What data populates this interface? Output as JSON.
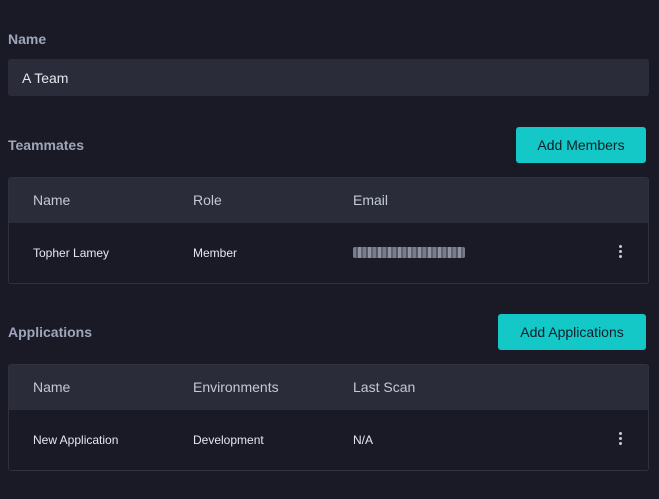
{
  "name_field": {
    "label": "Name",
    "value": "A Team"
  },
  "teammates": {
    "title": "Teammates",
    "add_button": "Add Members",
    "columns": [
      "Name",
      "Role",
      "Email"
    ],
    "rows": [
      {
        "name": "Topher Lamey",
        "role": "Member"
      }
    ]
  },
  "applications": {
    "title": "Applications",
    "add_button": "Add Applications",
    "columns": [
      "Name",
      "Environments",
      "Last Scan"
    ],
    "rows": [
      {
        "name": "New Application",
        "environment": "Development",
        "last_scan": "N/A"
      }
    ]
  },
  "colors": {
    "background": "#1a1a27",
    "panel": "#2a2c3a",
    "accent": "#14c8c8"
  },
  "icons": {
    "row_menu": "more-vertical-icon"
  }
}
